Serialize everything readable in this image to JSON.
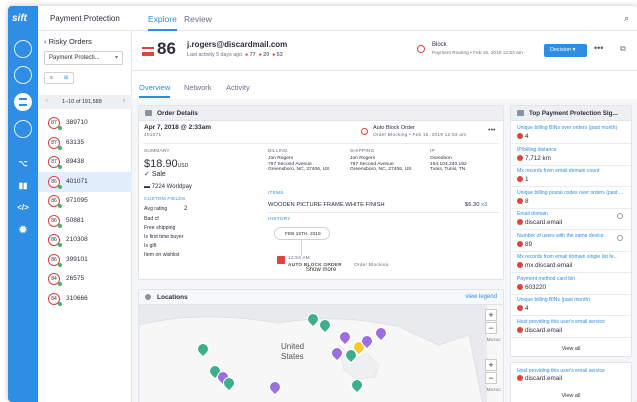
{
  "app": {
    "logo": "sift",
    "title": "Payment Protection",
    "tabs": [
      "Explore",
      "Review"
    ]
  },
  "list": {
    "title": "Risky Orders",
    "select": "Payment Protecti...",
    "toggle": [
      "≡",
      "⊞"
    ],
    "pagination": "1–10 of 191,588",
    "rows": [
      {
        "score": "87",
        "id": "389710"
      },
      {
        "score": "87",
        "id": "63135"
      },
      {
        "score": "87",
        "id": "89438"
      },
      {
        "score": "86",
        "id": "401071",
        "selected": true
      },
      {
        "score": "86",
        "id": "971095"
      },
      {
        "score": "86",
        "id": "50881"
      },
      {
        "score": "86",
        "id": "210308"
      },
      {
        "score": "86",
        "id": "399101"
      },
      {
        "score": "84",
        "id": "26575"
      },
      {
        "score": "84",
        "id": "310666"
      }
    ]
  },
  "user": {
    "score": "86",
    "email": "j.rogers@discardmail.com",
    "meta": "Last activity 5 days ago",
    "count1": "77",
    "count2": "20",
    "count3": "53",
    "block_title": "Block",
    "block_sub": "Payment Routing • Feb 15, 2019 12:53 am",
    "decision_label": "Decision ▾",
    "more": "•••"
  },
  "subtabs": [
    "Overview",
    "Network",
    "Activity"
  ],
  "order": {
    "header": "Order Details",
    "date": "Apr 7, 2018 @ 2:33am",
    "order_id": "401071",
    "auto_block": "Auto Block Order",
    "auto_block_sub": "Order Blocking • Feb 15, 2019 12:53 am",
    "summary_label": "SUMMARY",
    "amount": "$18.90",
    "currency": "USD",
    "sale": "Sale",
    "card": "7224 Worldpay",
    "custom_label": "CUSTOM FIELDS",
    "avg_label": "Avg rating",
    "avg_val": "2",
    "custom_fields": [
      "Bad cf",
      "Free shipping",
      "Is first time buyer",
      "Is gift",
      "Item on wishlist"
    ],
    "billing_label": "BILLING",
    "billing": [
      "Jon Rogers",
      "767 Second Avenue",
      "Greensboro, NC, 27406, US"
    ],
    "shipping_label": "SHIPPING",
    "shipping": [
      "Jon Rogers",
      "767 Second Avenue",
      "Greensboro, NC, 27406, US"
    ],
    "ip_label": "IP",
    "ip": [
      "Ooredoon",
      "154.104.240.192",
      "Tunis, Tunis, TN"
    ],
    "items_label": "ITEMS",
    "item": "WOODEN PICTURE FRAME WHITE FINISH",
    "item_price": "$6.30",
    "item_qty": "x3",
    "history_label": "HISTORY",
    "history_date": "FEB 15TH, 2019",
    "history_time": "12:53 AM",
    "history_event": "AUTO BLOCK ORDER",
    "history_event2": "Order Blocking",
    "show_more": "Show more"
  },
  "locations": {
    "header": "Locations",
    "view_legend": "view legend",
    "country": "United\nStates",
    "zoom_in": "+",
    "zoom_out": "−",
    "side": "Moroc"
  },
  "signals": {
    "header": "Top Payment Protection Sig...",
    "items": [
      {
        "label": "Unique billing BINs over orders (past month)",
        "value": "4"
      },
      {
        "label": "IP/billing distance",
        "value": "7,712 km"
      },
      {
        "label": "Mx records from email domain count",
        "value": "1"
      },
      {
        "label": "Unique billing postal codes over orders (past ...",
        "value": "8"
      },
      {
        "label": "Email domain",
        "value": "discard.email"
      },
      {
        "label": "Number of users with the same device",
        "value": "89"
      },
      {
        "label": "Mx records from email domain single list fe...",
        "value": "mx.discard.email"
      },
      {
        "label": "Payment method card bin",
        "value": "603220"
      },
      {
        "label": "Unique billing BINs (past month)",
        "value": "4"
      },
      {
        "label": "Host providing this user's email service",
        "value": "discard.email"
      }
    ],
    "view_all": "View all",
    "extra": {
      "label": "Host providing this user's email service",
      "value": "discard.email"
    }
  }
}
